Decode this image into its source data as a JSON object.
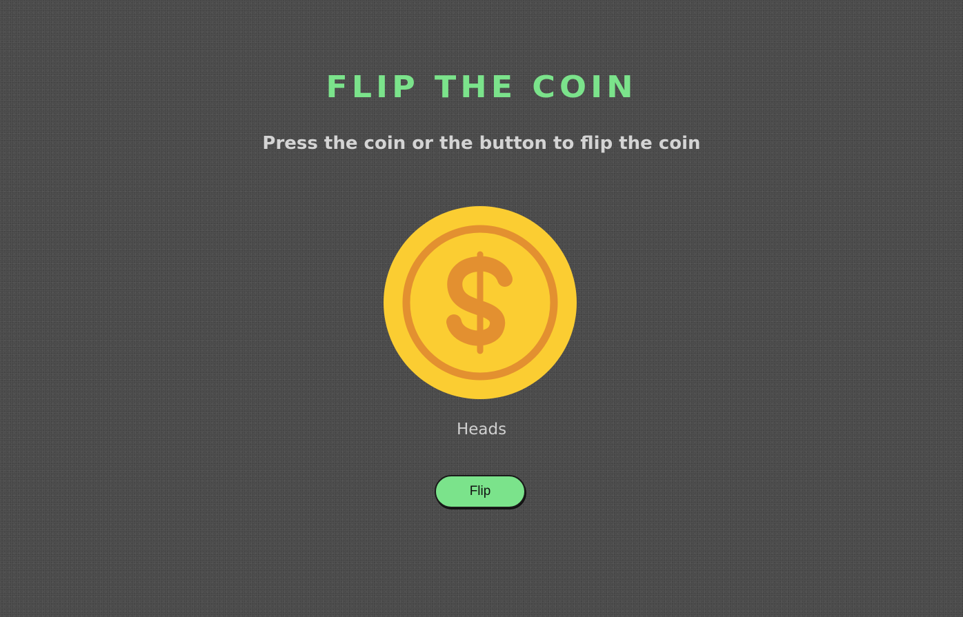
{
  "header": {
    "title": "FLIP THE COIN",
    "subtitle": "Press the coin or the button to flip the coin"
  },
  "coin": {
    "face": "heads",
    "icon": "dollar-coin-icon",
    "outer_color": "#fbcd32",
    "ring_color": "#e39030",
    "symbol_color": "#e39030"
  },
  "result": {
    "text": "Heads"
  },
  "controls": {
    "flip_label": "Flip",
    "button_color": "#7be38b"
  },
  "theme": {
    "accent": "#7be38b",
    "background": "#4a4a4a",
    "text": "#d4d4d4"
  }
}
